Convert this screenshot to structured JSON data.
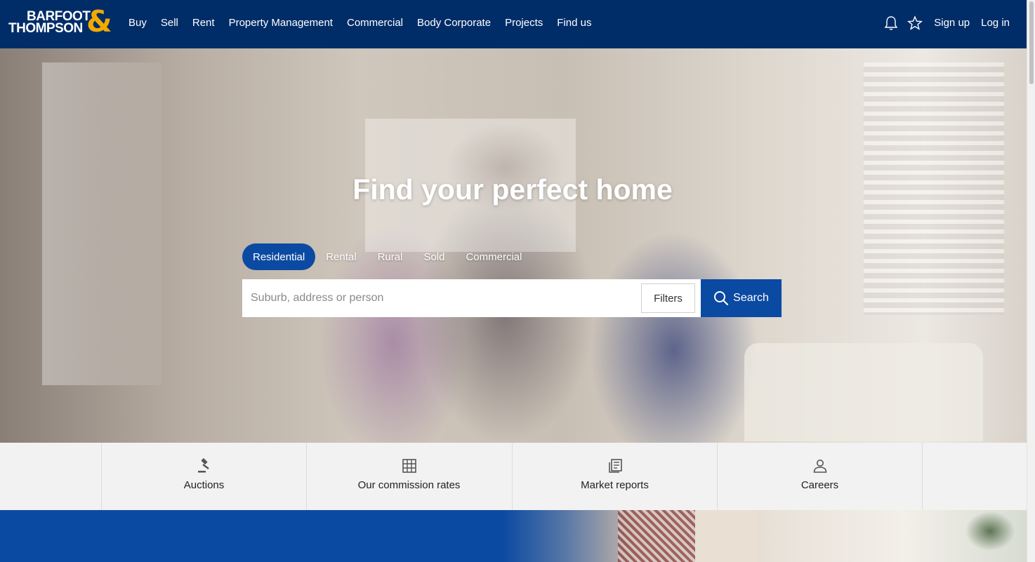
{
  "brand": {
    "line1": "BARFOOT",
    "line2": "THOMPSON",
    "amp": "&",
    "accent": "#f2a900",
    "primary": "#002d68",
    "button_blue": "#0b4aa2"
  },
  "nav": {
    "items": [
      "Buy",
      "Sell",
      "Rent",
      "Property Management",
      "Commercial",
      "Body Corporate",
      "Projects",
      "Find us"
    ],
    "signup": "Sign up",
    "login": "Log in",
    "icons": [
      "bell-icon",
      "star-icon"
    ]
  },
  "hero": {
    "title": "Find your perfect home",
    "tabs": [
      "Residential",
      "Rental",
      "Rural",
      "Sold",
      "Commercial"
    ],
    "active_tab": "Residential",
    "search_placeholder": "Suburb, address or person",
    "filters_label": "Filters",
    "search_label": "Search"
  },
  "quick_links": [
    {
      "label": "Auctions",
      "icon": "gavel-icon"
    },
    {
      "label": "Our commission rates",
      "icon": "grid-icon"
    },
    {
      "label": "Market reports",
      "icon": "reports-icon"
    },
    {
      "label": "Careers",
      "icon": "person-icon"
    }
  ]
}
